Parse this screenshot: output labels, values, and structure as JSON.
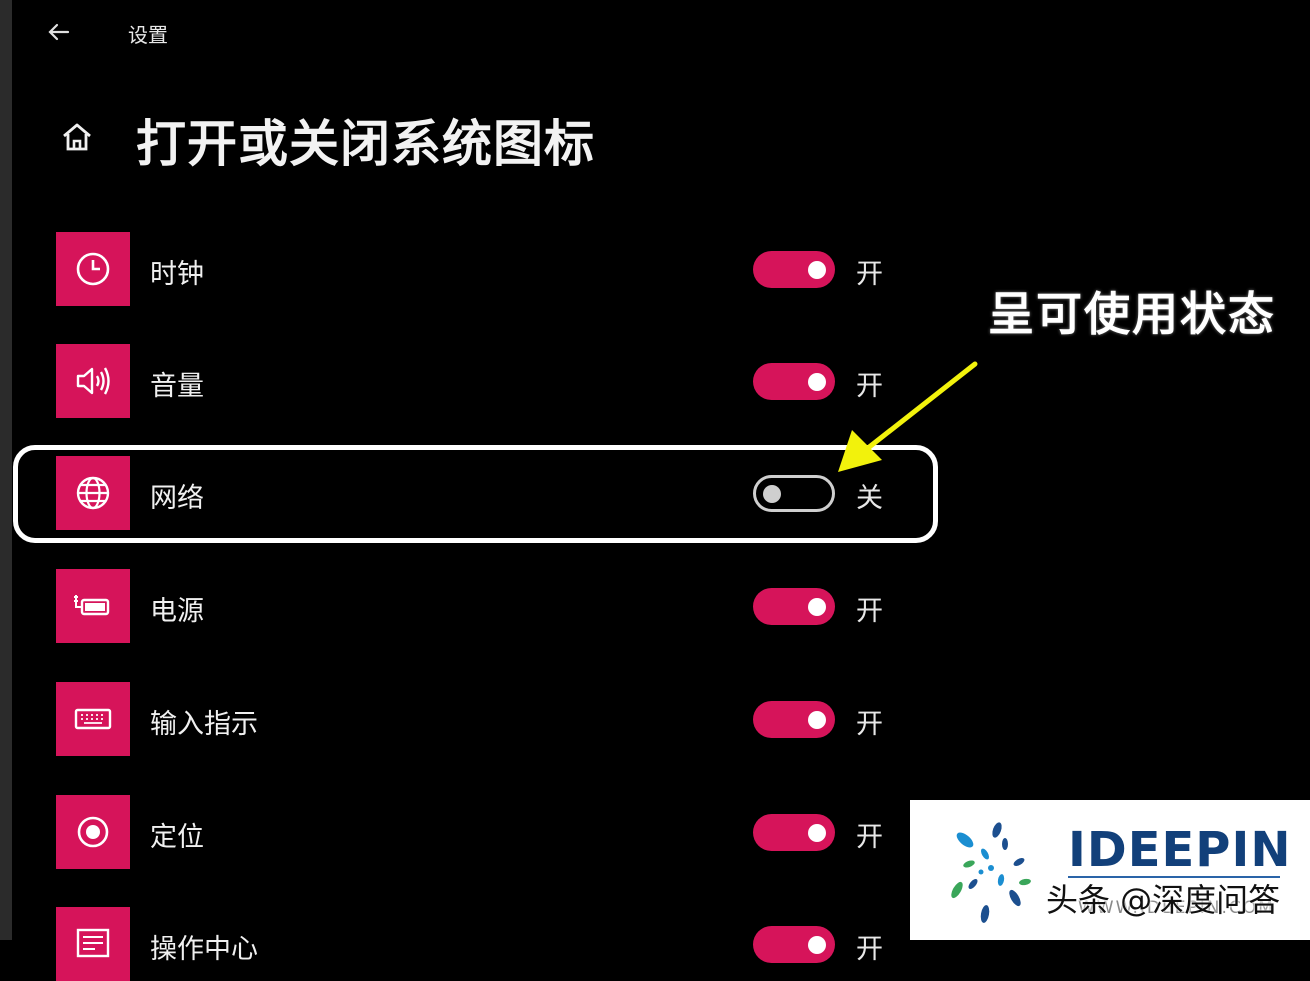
{
  "window": {
    "app_title": "设置"
  },
  "header": {
    "page_title": "打开或关闭系统图标"
  },
  "accent_color": "#d6145a",
  "settings": [
    {
      "label": "时钟",
      "icon": "clock-icon",
      "on": true,
      "state_text": "开"
    },
    {
      "label": "音量",
      "icon": "volume-icon",
      "on": true,
      "state_text": "开"
    },
    {
      "label": "网络",
      "icon": "globe-icon",
      "on": false,
      "state_text": "关"
    },
    {
      "label": "电源",
      "icon": "battery-icon",
      "on": true,
      "state_text": "开"
    },
    {
      "label": "输入指示",
      "icon": "keyboard-icon",
      "on": true,
      "state_text": "开"
    },
    {
      "label": "定位",
      "icon": "location-icon",
      "on": true,
      "state_text": "开"
    },
    {
      "label": "操作中心",
      "icon": "action-center-icon",
      "on": true,
      "state_text": "开"
    }
  ],
  "annotation": {
    "callout": "呈可使用状态",
    "arrow_color": "#f2f20c"
  },
  "watermark": {
    "brand": "IDEEPIN",
    "brand_main": "IDEEP",
    "brand_accent": "IN",
    "url": "WWW.IDEEPIN.COM",
    "channel": "头条 @深度问答"
  }
}
